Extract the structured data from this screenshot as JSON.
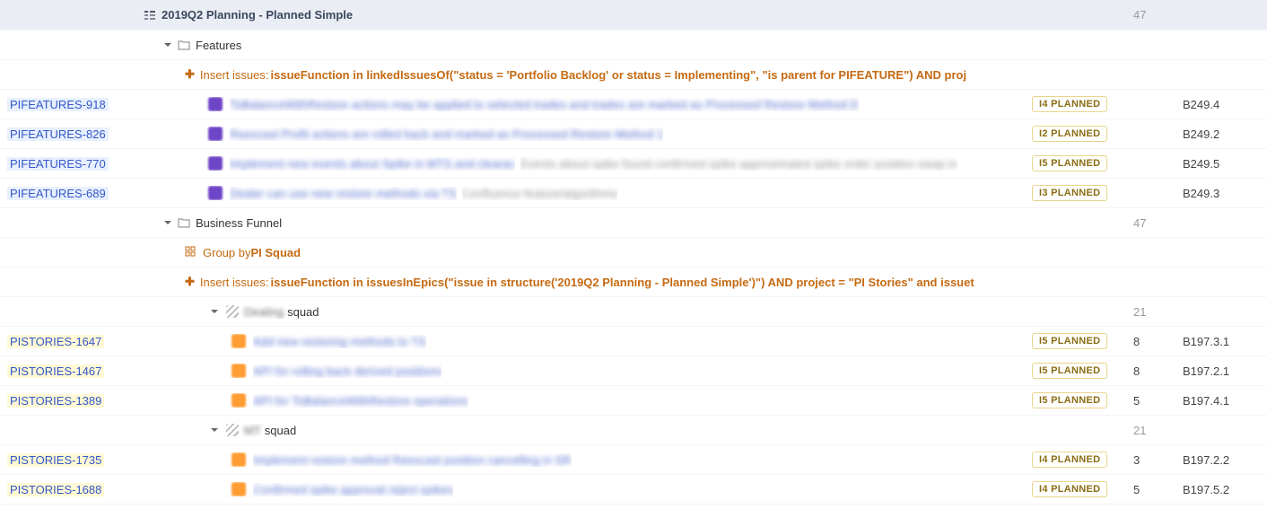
{
  "header": {
    "title": "2019Q2 Planning - Planned Simple",
    "count": 47
  },
  "features": {
    "label": "Features",
    "insert_prefix": "Insert issues: ",
    "insert_query": "issueFunction in linkedIssuesOf(\"status = 'Portfolio Backlog' or status = Implementing\", \"is parent for PIFEATURE\") AND proj",
    "rows": [
      {
        "key": "PIFEATURES-918",
        "icon_color": "purple",
        "blur": "ToBalanceWithRestore actions may be applied to selected trades and trades are marked as Processed Restore Method D",
        "status": "I4 PLANNED",
        "value": "B249.4"
      },
      {
        "key": "PIFEATURES-826",
        "icon_color": "purple",
        "blur": "Reexcast Profit actions are rolled back and marked as Processed Restore Method 1",
        "status": "I2 PLANNED",
        "value": "B249.2"
      },
      {
        "key": "PIFEATURES-770",
        "icon_color": "purple",
        "blur": "Implement new events about Spike in MTS and clearac",
        "blur_grey": "Events about spike found confirmed spike approximated spike order position swap in",
        "status": "I5 PLANNED",
        "value": "B249.5"
      },
      {
        "key": "PIFEATURES-689",
        "icon_color": "purple",
        "blur": "Dealer can use new restore methods via TS",
        "blur_grey": "Confluence feature/algorithms",
        "status": "I3 PLANNED",
        "value": "B249.3"
      }
    ]
  },
  "funnel": {
    "label": "Business Funnel",
    "count": 47,
    "group_prefix": "Group by ",
    "group_field": "PI Squad",
    "insert_prefix": "Insert issues: ",
    "insert_query": "issueFunction in issuesInEpics(\"issue in structure('2019Q2 Planning - Planned Simple')\") AND project = \"PI Stories\" and issuet",
    "squads": [
      {
        "name_blur": "Dealing",
        "name_suffix": "squad",
        "count": 21,
        "rows": [
          {
            "key": "PISTORIES-1647",
            "blur": "Add new restoring methods to TS",
            "status": "I5 PLANNED",
            "num": 8,
            "value": "B197.3.1"
          },
          {
            "key": "PISTORIES-1467",
            "blur": "API for rolling back derived positions",
            "status": "I5 PLANNED",
            "num": 8,
            "value": "B197.2.1"
          },
          {
            "key": "PISTORIES-1389",
            "blur": "API for ToBalanceWithRestore operations",
            "status": "I5 PLANNED",
            "num": 5,
            "value": "B197.4.1"
          }
        ]
      },
      {
        "name_blur": "MT",
        "name_suffix": "squad",
        "count": 21,
        "rows": [
          {
            "key": "PISTORIES-1735",
            "blur": "Implement restore method Reexcast position cancelling in SR",
            "status": "I4 PLANNED",
            "num": 3,
            "value": "B197.2.2"
          },
          {
            "key": "PISTORIES-1688",
            "blur": "Confirmed spike approval reject spikes",
            "status": "I4 PLANNED",
            "num": 5,
            "value": "B197.5.2"
          }
        ]
      }
    ]
  }
}
